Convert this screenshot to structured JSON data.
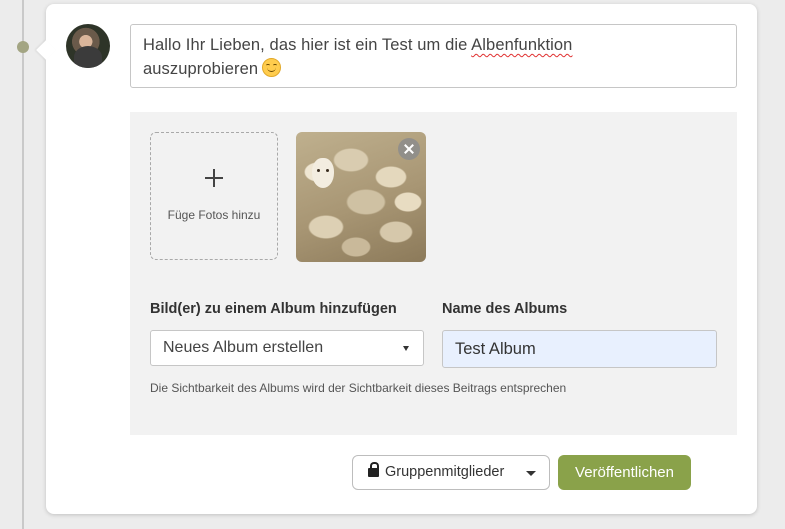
{
  "composer": {
    "text_before": "Hallo Ihr Lieben, das hier ist ein Test um die ",
    "text_misspelled": "Albenfunktion",
    "text_after": "auszuprobieren",
    "emoji": "smiling-face-emoji"
  },
  "album": {
    "add_photos_label": "Füge Fotos hinzu",
    "add_to_album_label": "Bild(er) zu einem Album hinzufügen",
    "album_select_value": "Neues Album erstellen",
    "album_name_label": "Name des Albums",
    "album_name_value": "Test Album",
    "visibility_note": "Die Sichtbarkeit des Albums wird der Sichtbarkeit dieses Beitrags entsprechen"
  },
  "footer": {
    "audience_label": "Gruppenmitglieder",
    "publish_label": "Veröffentlichen"
  },
  "colors": {
    "accent": "#8aa24a",
    "timeline_dot": "#a3a583",
    "autofill_bg": "#e8f0fe"
  }
}
